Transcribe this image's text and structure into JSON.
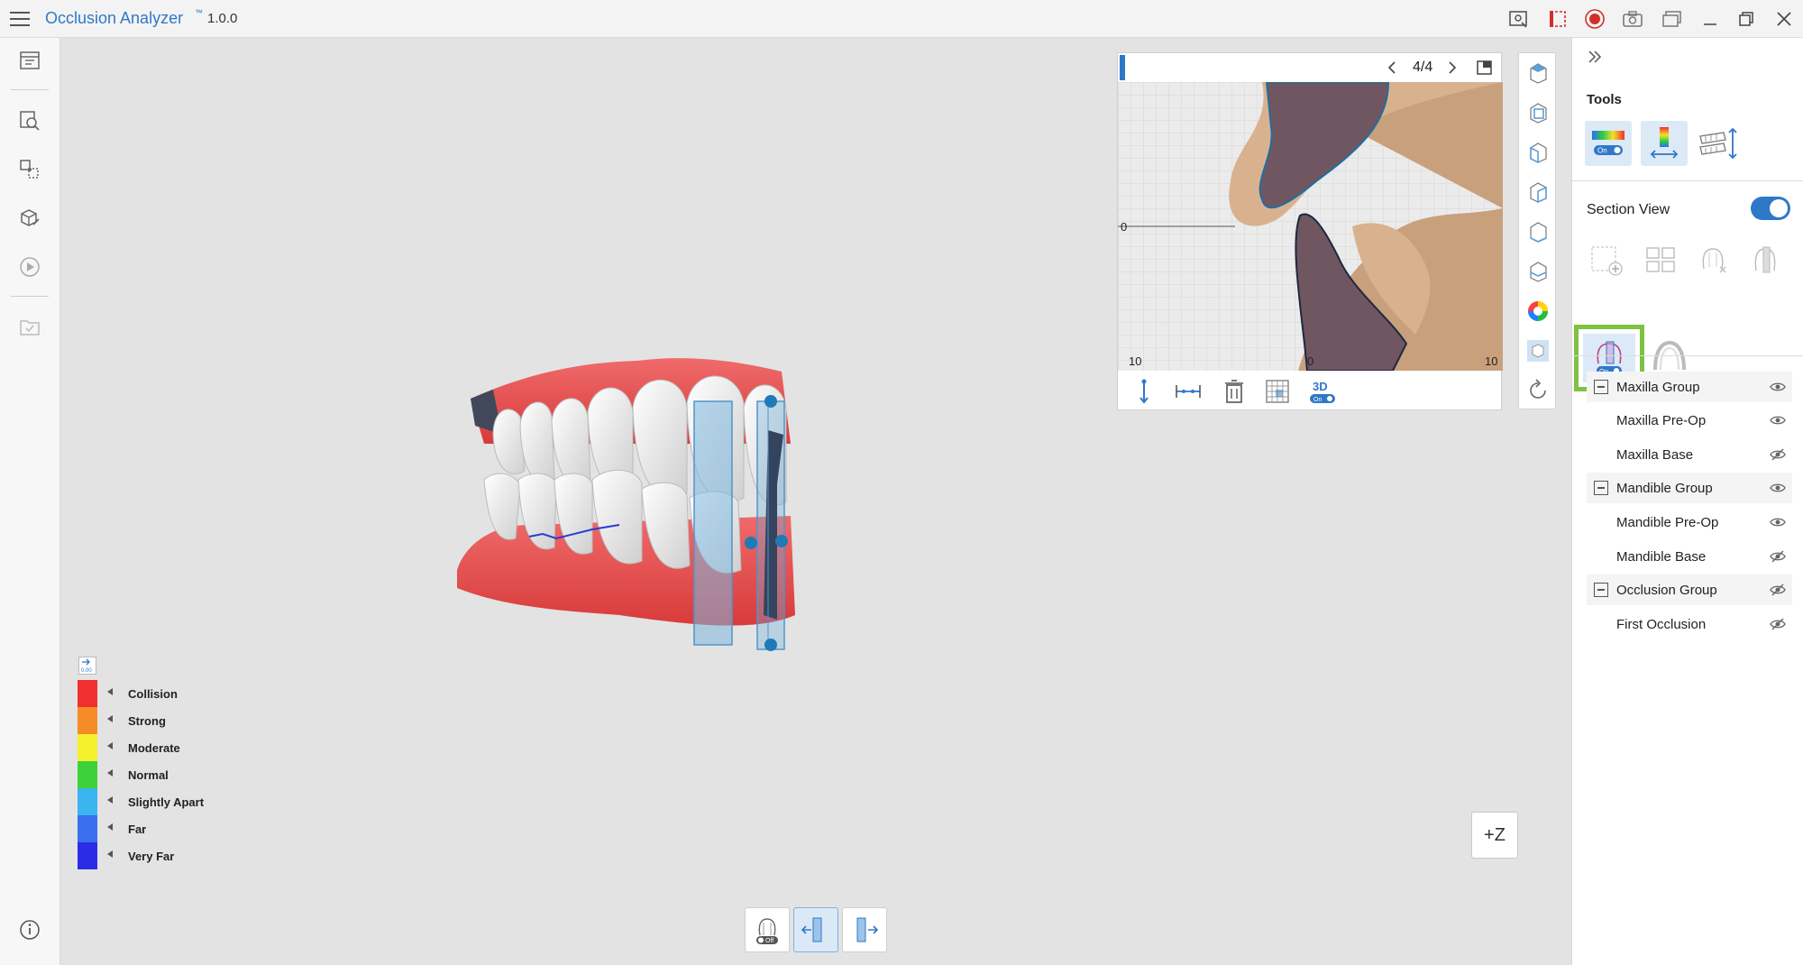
{
  "app": {
    "title": "Occlusion Analyzer",
    "tm": "™",
    "version": "1.0.0"
  },
  "section_window": {
    "page": "4/4",
    "axis_labels": {
      "left_mid": "0",
      "bottom_left": "10",
      "bottom_mid": "0",
      "bottom_right": "10"
    }
  },
  "legend": {
    "items": [
      {
        "label": "Collision",
        "color": "#f0302e"
      },
      {
        "label": "Strong",
        "color": "#f58c28"
      },
      {
        "label": "Moderate",
        "color": "#f4f02c"
      },
      {
        "label": "Normal",
        "color": "#3ed23a"
      },
      {
        "label": "Slightly Apart",
        "color": "#39b6ef"
      },
      {
        "label": "Far",
        "color": "#3a6ff0"
      },
      {
        "label": "Very Far",
        "color": "#2b2de6"
      }
    ],
    "icon_label": "0.00"
  },
  "zoom_button": {
    "label": "+Z"
  },
  "right_panel": {
    "tools_title": "Tools",
    "section_view_label": "Section View",
    "section_view_on": true,
    "tree": [
      {
        "label": "Maxilla Group",
        "group": true,
        "visible": true
      },
      {
        "label": "Maxilla Pre-Op",
        "group": false,
        "visible": true
      },
      {
        "label": "Maxilla Base",
        "group": false,
        "visible": false
      },
      {
        "label": "Mandible Group",
        "group": true,
        "visible": true
      },
      {
        "label": "Mandible Pre-Op",
        "group": false,
        "visible": true
      },
      {
        "label": "Mandible Base",
        "group": false,
        "visible": false
      },
      {
        "label": "Occlusion Group",
        "group": true,
        "visible": false
      },
      {
        "label": "First Occlusion",
        "group": false,
        "visible": false
      }
    ]
  },
  "colors": {
    "accent": "#2f78c8",
    "highlight": "#7dc242"
  }
}
